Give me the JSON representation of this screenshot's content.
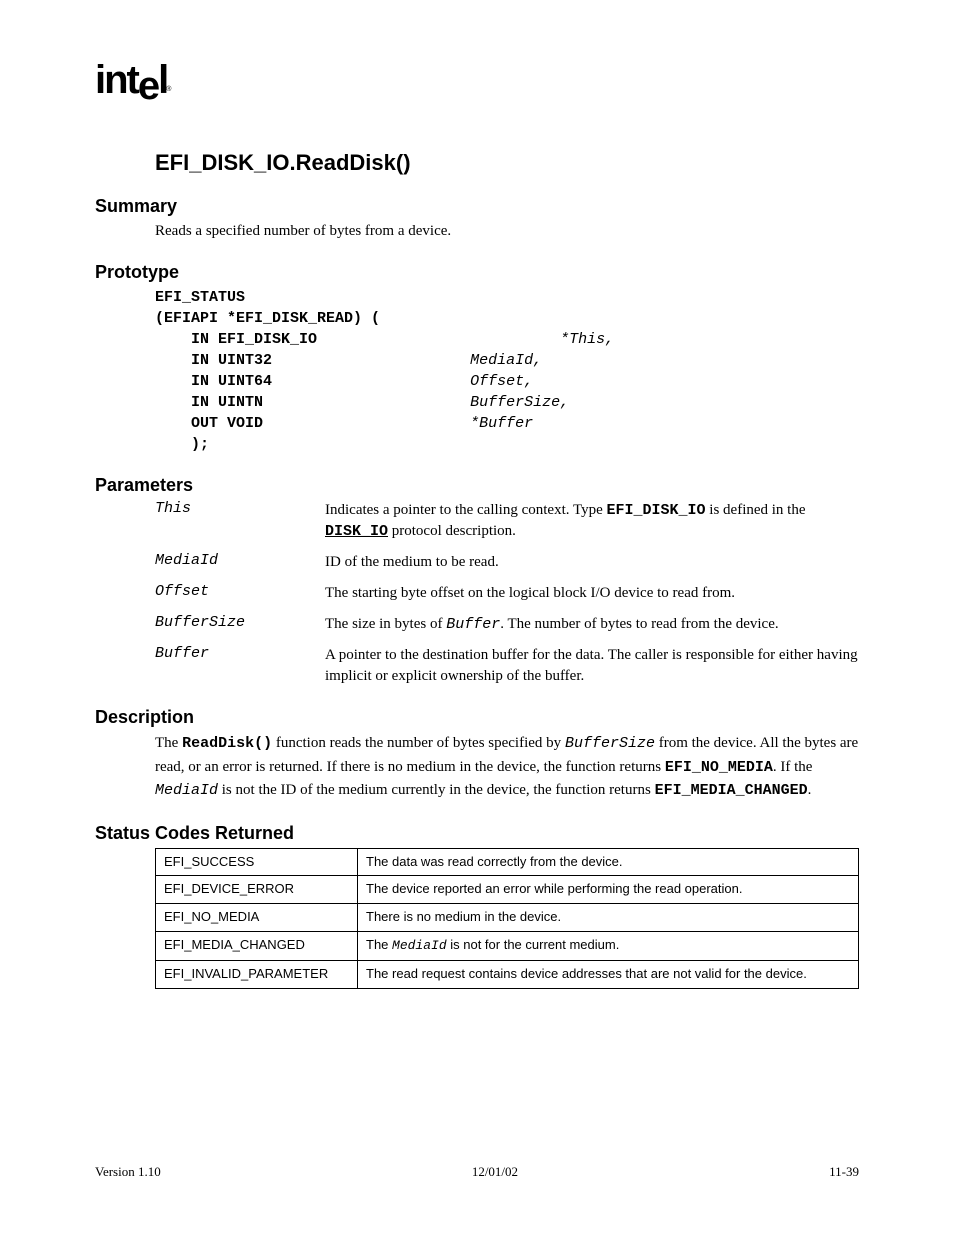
{
  "logo": "intel",
  "section": "EFI_DISK_IO.ReadDisk()",
  "headings": {
    "summary": "Summary",
    "prototype": "Prototype",
    "parameters": "Parameters",
    "description": "Description",
    "status": "Status Codes Returned"
  },
  "summary_text": "Reads a specified number of bytes from a device.",
  "prototype": {
    "l1": "EFI_STATUS",
    "l2": "(EFIAPI *EFI_DISK_READ) (",
    "rows": [
      {
        "kw": "    IN EFI_DISK_IO",
        "param": "*This,"
      },
      {
        "kw": "    IN UINT32",
        "param": "MediaId,"
      },
      {
        "kw": "    IN UINT64",
        "param": "Offset,"
      },
      {
        "kw": "    IN UINTN",
        "param": "BufferSize,"
      },
      {
        "kw": "    OUT VOID",
        "param": "*Buffer"
      }
    ],
    "close": "    );"
  },
  "params": [
    {
      "name": "This",
      "pre1": "Indicates a pointer to the calling context.  Type ",
      "code1": "EFI_DISK_IO",
      "mid1": " is defined in the ",
      "link": "DISK_IO",
      "post1": " protocol description."
    },
    {
      "name": "MediaId",
      "plain": "ID of the medium to be read."
    },
    {
      "name": "Offset",
      "plain": "The starting byte offset on the logical block I/O device to read from."
    },
    {
      "name": "BufferSize",
      "pre1": "The size in bytes of ",
      "ital1": "Buffer",
      "post1": ".  The number of bytes to read from the device."
    },
    {
      "name": "Buffer",
      "plain": "A pointer to the destination buffer for the data.  The caller is responsible for either having implicit or explicit ownership of the buffer."
    }
  ],
  "description": {
    "t1": "The ",
    "fn": "ReadDisk()",
    "t2": " function reads the number of bytes specified by ",
    "p1": "BufferSize",
    "t3": " from the device.  All the bytes are read, or an error is returned.  If there is no medium in the device, the function returns ",
    "c1": "EFI_NO_MEDIA",
    "t4": ".  If the ",
    "p2": "MediaId",
    "t5": " is not the ID of the medium currently in the device, the function returns ",
    "c2": "EFI_MEDIA_CHANGED",
    "t6": "."
  },
  "status": [
    {
      "code": "EFI_SUCCESS",
      "desc": "The data was read correctly from the device."
    },
    {
      "code": "EFI_DEVICE_ERROR",
      "desc": "The device reported an error while performing the read operation."
    },
    {
      "code": "EFI_NO_MEDIA",
      "desc": "There is no medium in the device."
    },
    {
      "code": "EFI_MEDIA_CHANGED",
      "ital": "MediaId",
      "pre": "The ",
      "post": " is not for the current medium."
    },
    {
      "code": "EFI_INVALID_PARAMETER",
      "desc": "The read request contains device addresses that are not valid for the device."
    }
  ],
  "footer": {
    "left": "Version 1.10",
    "center": "12/01/02",
    "right": "11-39"
  }
}
